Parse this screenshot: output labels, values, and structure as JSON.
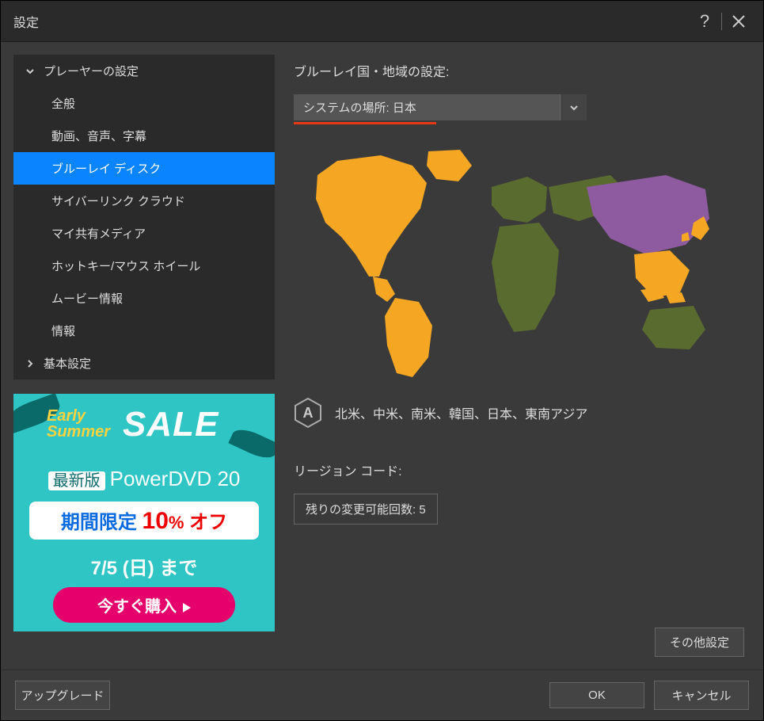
{
  "window": {
    "title": "設定"
  },
  "sidebar": {
    "group_player": {
      "label": "プレーヤーの設定",
      "expanded": true,
      "items": [
        {
          "label": "全般"
        },
        {
          "label": "動画、音声、字幕"
        },
        {
          "label": "ブルーレイ ディスク",
          "active": true
        },
        {
          "label": "サイバーリンク クラウド"
        },
        {
          "label": "マイ共有メディア"
        },
        {
          "label": "ホットキー/マウス ホイール"
        },
        {
          "label": "ムービー情報"
        },
        {
          "label": "情報"
        }
      ]
    },
    "group_basic": {
      "label": "基本設定",
      "expanded": false
    }
  },
  "promo": {
    "early": "Early",
    "summer": "Summer",
    "sale": "SALE",
    "line2_badge": "最新版",
    "line2_text": "PowerDVD 20",
    "box_blue": "期間限定",
    "box_num": "10",
    "box_percent": "%",
    "box_off": "オフ",
    "date": "7/5 (日) まで",
    "cta": "今すぐ購入"
  },
  "main": {
    "section_label": "ブルーレイ国・地域の設定:",
    "dropdown_value": "システムの場所: 日本",
    "region_letter": "A",
    "region_list": "北米、中米、南米、韓国、日本、東南アジア",
    "region_code_label": "リージョン コード:",
    "changes_remaining": "残りの変更可能回数: 5",
    "other_settings": "その他設定"
  },
  "footer": {
    "upgrade": "アップグレード",
    "ok": "OK",
    "cancel": "キャンセル"
  },
  "colors": {
    "region_a": "#f5a623",
    "region_other": "#5a6b2f",
    "region_asia": "#8e5aa0"
  }
}
